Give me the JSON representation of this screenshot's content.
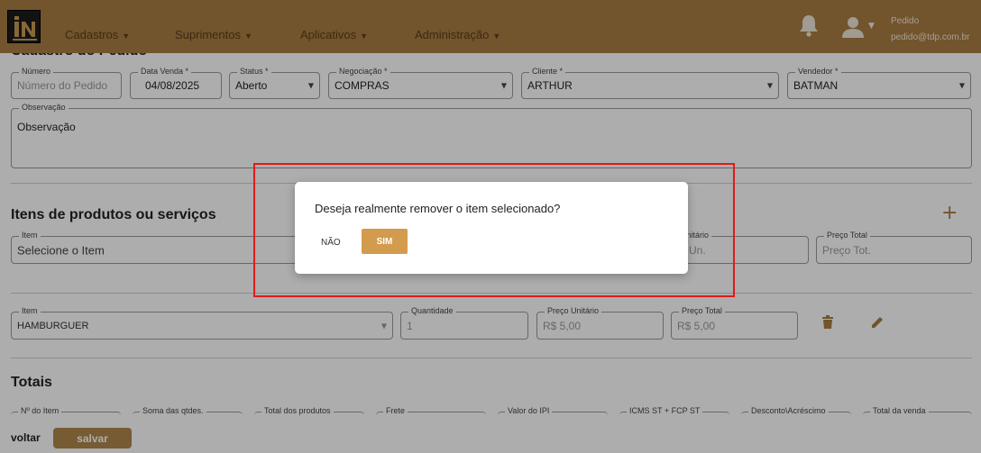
{
  "header": {
    "nav": [
      {
        "label": "Cadastros"
      },
      {
        "label": "Suprimentos"
      },
      {
        "label": "Aplicativos"
      },
      {
        "label": "Administração"
      }
    ],
    "user_name": "Pedido",
    "user_email": "pedido@tdp.com.br",
    "accent_color": "#a97c43"
  },
  "order": {
    "section_title": "Cadastro do Pedido",
    "numero": {
      "label": "Número",
      "placeholder": "Número do Pedido"
    },
    "data_venda": {
      "label": "Data Venda *",
      "value": "04/08/2025"
    },
    "status": {
      "label": "Status *",
      "value": "Aberto"
    },
    "negociacao": {
      "label": "Negociação *",
      "value": "COMPRAS"
    },
    "cliente": {
      "label": "Cliente *",
      "value": "ARTHUR"
    },
    "vendedor": {
      "label": "Vendedor *",
      "value": "BATMAN"
    },
    "observacao": {
      "label": "Observação",
      "placeholder": "Observação"
    }
  },
  "items_section": {
    "title": "Itens de produtos ou serviços",
    "new_item": {
      "item_label": "Item",
      "item_placeholder": "Selecione o Item",
      "unit_label": "Unitário",
      "unit_placeholder": "Un.",
      "total_label": "Preço Total",
      "total_placeholder": "Preço Tot."
    },
    "row": {
      "item_label": "Item",
      "item_value": "HAMBURGUER",
      "qty_label": "Quantidade",
      "qty_value": "1",
      "unit_label": "Preço Unitário",
      "unit_value": "R$ 5,00",
      "total_label": "Preço Total",
      "total_value": "R$ 5,00"
    }
  },
  "totals": {
    "title": "Totais",
    "fields": [
      {
        "label": "Nº do Item"
      },
      {
        "label": "Soma das qtdes."
      },
      {
        "label": "Total dos produtos"
      },
      {
        "label": "Frete"
      },
      {
        "label": "Valor do IPI"
      },
      {
        "label": "ICMS ST + FCP ST"
      },
      {
        "label": "Desconto\\Acréscimo"
      },
      {
        "label": "Total da venda"
      }
    ]
  },
  "footer": {
    "voltar_label": "voltar",
    "salvar_label": "salvar"
  },
  "dialog": {
    "message": "Deseja realmente remover o item selecionado?",
    "no_label": "NÃO",
    "yes_label": "SIM",
    "yes_color": "#d39b4d"
  }
}
